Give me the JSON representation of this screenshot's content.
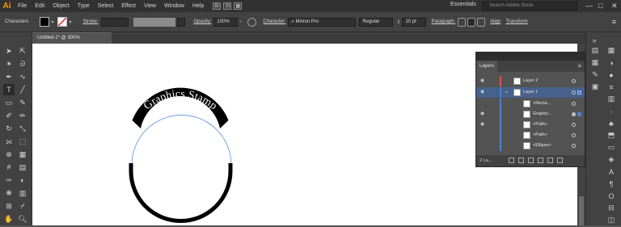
{
  "app": {
    "logo": "Ai"
  },
  "menu": {
    "items": [
      "File",
      "Edit",
      "Object",
      "Type",
      "Select",
      "Effect",
      "View",
      "Window",
      "Help"
    ],
    "icon1": "Br",
    "icon2": "St"
  },
  "workspace": {
    "essentials": "Essentials",
    "search_placeholder": "Search Adobe Stock"
  },
  "window_controls": {
    "minimize": "—",
    "maximize": "□",
    "close": "✕"
  },
  "control_bar": {
    "characters_label": "Characters",
    "stroke_label": "Stroke:",
    "opacity_label": "Opacity:",
    "opacity_value": "100%",
    "character_label": "Character:",
    "font_family": "Minion Pro",
    "font_style": "Regular",
    "font_size": "10 pt",
    "paragraph_label": "Paragraph:",
    "align_label": "Align",
    "transform_label": "Transform"
  },
  "document": {
    "tab_title": "Untitled-1* @ 300% (RGB/Preview)",
    "close_glyph": "×"
  },
  "artwork": {
    "curved_text": "Graphics Stamp"
  },
  "layers_panel": {
    "tab_label": "Layers",
    "footer_label": "2 La...",
    "rows": [
      {
        "name": "Layer 2"
      },
      {
        "name": "Layer 1"
      },
      {
        "name": "<Recta..."
      },
      {
        "name": "Graphic..."
      },
      {
        "name": "<Path>"
      },
      {
        "name": "<Path>"
      },
      {
        "name": "<Ellipse>"
      }
    ]
  },
  "colors": {
    "layer2_bar": "#e05252",
    "layer1_bar": "#4f7fd4",
    "selection": "#45618c",
    "path_stroke": "#000000",
    "path_hairline": "#3f7fd9",
    "text_fill": "#000000"
  }
}
